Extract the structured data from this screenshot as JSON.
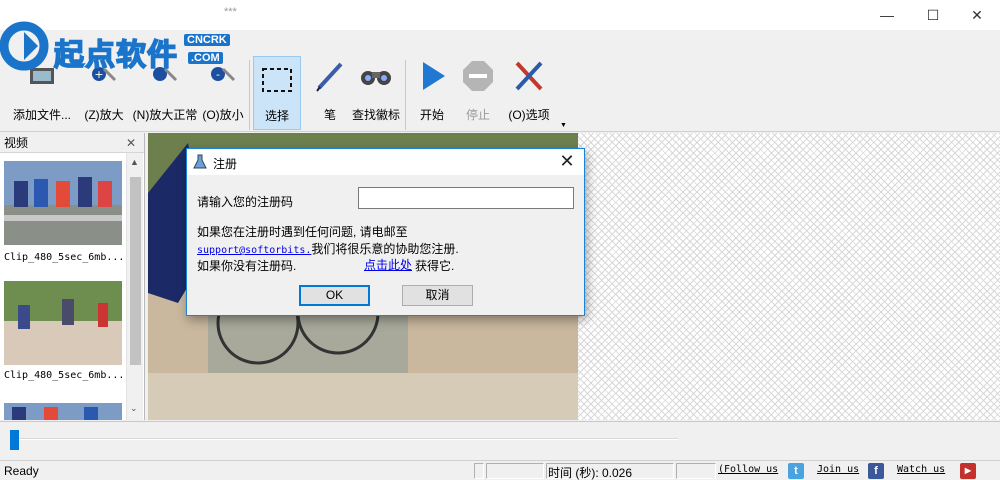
{
  "window": {
    "title": "***",
    "minimize": "—",
    "maximize": "☐",
    "close": "✕"
  },
  "logo": {
    "text": "起点软件",
    "badge_top": "CNCRK",
    "badge_bottom": ".COM"
  },
  "toolbar": {
    "add_file": "添加文件...",
    "zoom_in": "(Z)放大",
    "zoom_normal": "(N)放大正常",
    "zoom_out": "(O)放小",
    "select": "选择",
    "pen": "笔",
    "find_logo": "查找徽标",
    "start": "开始",
    "stop": "停止",
    "options": "(O)选项",
    "dropdown": "▼"
  },
  "left_panel": {
    "title": "视频",
    "close": "✕",
    "scroll_up": "▲",
    "scroll_down": "⌄",
    "items": [
      {
        "label": "Clip_480_5sec_6mb..."
      },
      {
        "label": "Clip_480_5sec_6mb..."
      }
    ]
  },
  "status": {
    "ready": "Ready",
    "time_label": "时间 (秒): 0.026",
    "follow": "Follow us",
    "follow_prefix": "(",
    "join": "Join us",
    "watch": "Watch us",
    "twitter_icon": "t",
    "facebook_icon": "f",
    "youtube_icon": "▶"
  },
  "timeline": {
    "position": 0.0
  },
  "dialog": {
    "title": "注册",
    "close": "✕",
    "prompt": "请输入您的注册码",
    "input_value": "",
    "line1": "如果您在注册时遇到任何问题, 请电邮至",
    "email": "support@softorbits.",
    "line2_rest": "我们将很乐意的协助您注册.",
    "line3": "如果你没有注册码.",
    "link": "点击此处",
    "get_it": "获得它.",
    "ok": "OK",
    "cancel": "取消"
  }
}
